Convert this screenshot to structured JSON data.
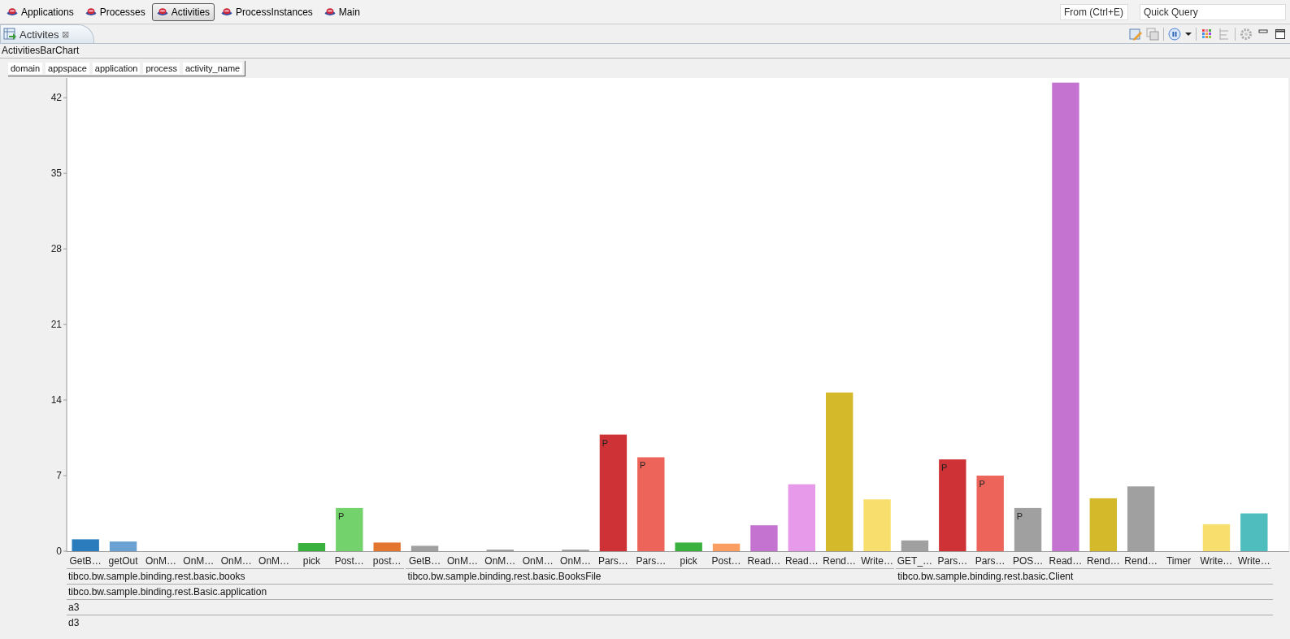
{
  "perspectives": [
    {
      "label": "Applications",
      "selected": false
    },
    {
      "label": "Processes",
      "selected": false
    },
    {
      "label": "Activities",
      "selected": true
    },
    {
      "label": "ProcessInstances",
      "selected": false
    },
    {
      "label": "Main",
      "selected": false
    }
  ],
  "search": {
    "from_placeholder": "From (Ctrl+E)",
    "query_placeholder": "Quick Query"
  },
  "view_tab": {
    "title": "Activites",
    "close": "⊠"
  },
  "chart_title": "ActivitiesBarChart",
  "fields": [
    {
      "label": "domain"
    },
    {
      "label": "appspace"
    },
    {
      "label": "application"
    },
    {
      "label": "process"
    },
    {
      "label": "activity_name"
    }
  ],
  "chart_data": {
    "type": "bar",
    "categories": [
      "GetB…",
      "getOut",
      "OnM…",
      "OnM…",
      "OnM…",
      "OnM…",
      "pick",
      "Post…",
      "post…",
      "GetB…",
      "OnM…",
      "OnM…",
      "OnM…",
      "OnM…",
      "Pars…",
      "Pars…",
      "pick",
      "Post…",
      "Read…",
      "Read…",
      "Rend…",
      "Write…",
      "GET_…",
      "Pars…",
      "Pars…",
      "POS…",
      "Read…",
      "Rend…",
      "Rend…",
      "Timer",
      "Write…",
      "Write…"
    ],
    "series": [
      {
        "name": "tibco.bw.sample.binding.rest.basic.books",
        "values": [
          1.1,
          0.9,
          0,
          0,
          0,
          0,
          0.75,
          4.0,
          0.8,
          null,
          null,
          null,
          null,
          null,
          null,
          null,
          null,
          null,
          null,
          null,
          null,
          null,
          null,
          null,
          null,
          null,
          null,
          null,
          null,
          null,
          null,
          null
        ],
        "colors": [
          "#2a7cbd",
          "#6ba2d4",
          "#a0a0a0",
          "#a0a0a0",
          "#a0a0a0",
          "#a0a0a0",
          "#3ab03e",
          "#74d26c",
          "#e4752e",
          null,
          null,
          null,
          null,
          null,
          null,
          null,
          null,
          null,
          null,
          null,
          null,
          null,
          null,
          null,
          null,
          null,
          null,
          null,
          null,
          null,
          null,
          null
        ]
      },
      {
        "name": "tibco.bw.sample.binding.rest.basic.BooksFile",
        "values": [
          null,
          null,
          null,
          null,
          null,
          null,
          null,
          null,
          null,
          0.5,
          0,
          0.15,
          0,
          0.15,
          10.8,
          8.7,
          0.8,
          0.7,
          2.4,
          6.2,
          14.7,
          4.8,
          null,
          null,
          null,
          null,
          null,
          null,
          null,
          null,
          null,
          null
        ],
        "colors": [
          null,
          null,
          null,
          null,
          null,
          null,
          null,
          null,
          null,
          "#a0a0a0",
          "#a0a0a0",
          "#a0a0a0",
          "#a0a0a0",
          "#a0a0a0",
          "#ce3236",
          "#ec645a",
          "#3ab03e",
          "#fb9e62",
          "#c573d0",
          "#e89aea",
          "#d4b92a",
          "#f8de6c",
          null,
          null,
          null,
          null,
          null,
          null,
          null,
          null,
          null,
          null
        ]
      },
      {
        "name": "tibco.bw.sample.binding.rest.basic.Client",
        "values": [
          null,
          null,
          null,
          null,
          null,
          null,
          null,
          null,
          null,
          null,
          null,
          null,
          null,
          null,
          null,
          null,
          null,
          null,
          null,
          null,
          null,
          null,
          1.0,
          8.5,
          7.0,
          4.0,
          43.4,
          4.9,
          6.0,
          0,
          2.5,
          3.5
        ],
        "colors": [
          null,
          null,
          null,
          null,
          null,
          null,
          null,
          null,
          null,
          null,
          null,
          null,
          null,
          null,
          null,
          null,
          null,
          null,
          null,
          null,
          null,
          null,
          "#a0a0a0",
          "#ce3236",
          "#ec645a",
          "#a0a0a0",
          "#c573d0",
          "#d4b92a",
          "#a0a0a0",
          "#a0a0a0",
          "#f8de6c",
          "#4fbcbd"
        ]
      }
    ],
    "ylim": [
      0,
      43.6
    ],
    "yticks": [
      0,
      7,
      14,
      21,
      28,
      35,
      42
    ],
    "value_labels": [
      null,
      null,
      null,
      null,
      null,
      null,
      null,
      "P",
      null,
      null,
      null,
      null,
      null,
      null,
      "P",
      "P",
      null,
      null,
      null,
      null,
      null,
      null,
      null,
      "P",
      "P",
      "P",
      null,
      null,
      null,
      null,
      null,
      null
    ]
  },
  "axis_levels": [
    "tibco.bw.sample.binding.rest.Basic.application",
    "a3",
    "d3"
  ]
}
